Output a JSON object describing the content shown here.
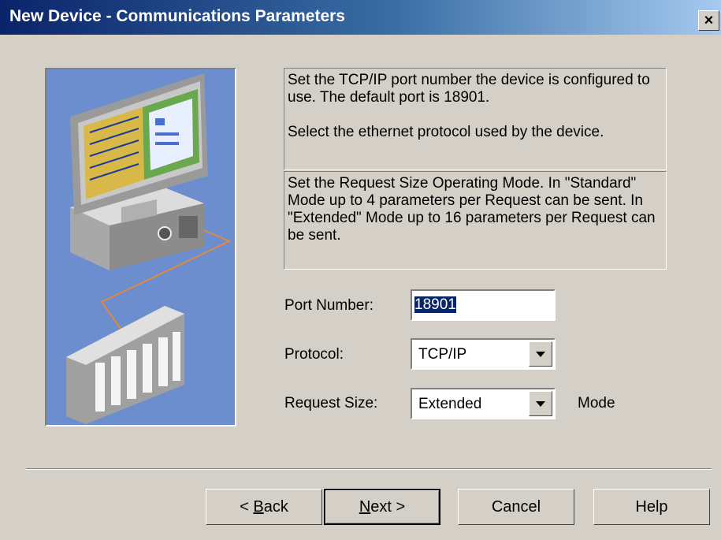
{
  "window": {
    "title": "New Device - Communications Parameters",
    "close_glyph": "×"
  },
  "info": {
    "p1": "Set the TCP/IP port number the device is configured to use. The default port is 18901.",
    "p2": "Select the ethernet protocol used by the device.",
    "p3": "Set the Request Size Operating Mode. In \"Standard\" Mode up to 4 parameters per Request can be sent.  In \"Extended\" Mode up to 16 parameters per Request can be sent."
  },
  "form": {
    "port_label": "Port Number:",
    "port_value": "18901",
    "protocol_label": "Protocol:",
    "protocol_value": "TCP/IP",
    "request_label": "Request Size:",
    "request_value": "Extended",
    "mode_suffix": "Mode"
  },
  "buttons": {
    "back_pre": "< ",
    "back_ul": "B",
    "back_post": "ack",
    "next_ul": "N",
    "next_post": "ext >",
    "cancel": "Cancel",
    "help": "Help"
  },
  "icons": {
    "illustration": "computer-connected-to-plc-illustration",
    "close": "close-icon",
    "dropdown": "chevron-down-icon"
  },
  "colors": {
    "title_bar_start": "#0a246a",
    "title_bar_end": "#a6caf0",
    "dialog_face": "#d4d0c8",
    "illustration_bg": "#6c8ecf",
    "selection": "#0a246a",
    "cable": "#e08a3c"
  }
}
